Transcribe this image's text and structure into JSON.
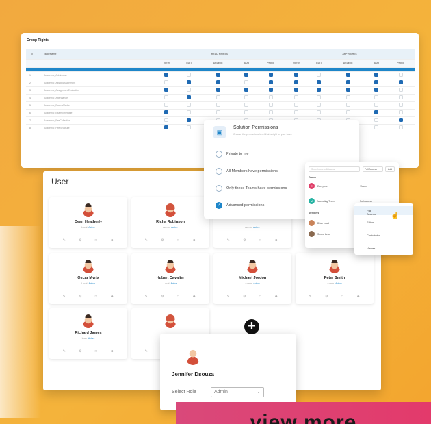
{
  "group_rights": {
    "title": "Group Rights",
    "col_index": "#",
    "col_module": "TableName",
    "group1": "READ RIGHTS",
    "group2": "APP RIGHTS",
    "sub_headers": [
      "VIEW",
      "EDIT",
      "DELETE",
      "ADD",
      "PRINT",
      "VIEW",
      "EDIT",
      "DELETE",
      "ADD",
      "PRINT"
    ],
    "rows": [
      {
        "n": "1",
        "name": "Academic_Admission",
        "checks": [
          1,
          0,
          1,
          1,
          1,
          1,
          0,
          1,
          1,
          0
        ]
      },
      {
        "n": "2",
        "name": "Academic_AssignAssignment",
        "checks": [
          0,
          1,
          1,
          0,
          1,
          1,
          1,
          1,
          1,
          1
        ]
      },
      {
        "n": "3",
        "name": "Academic_AssignmentEvaluation",
        "checks": [
          1,
          0,
          1,
          1,
          1,
          1,
          1,
          1,
          1,
          0
        ]
      },
      {
        "n": "4",
        "name": "Academic_Attendance",
        "checks": [
          0,
          1,
          0,
          0,
          0,
          0,
          0,
          0,
          0,
          0
        ]
      },
      {
        "n": "5",
        "name": "Academic_ExamsMarks",
        "checks": [
          0,
          0,
          0,
          0,
          0,
          0,
          0,
          0,
          0,
          0
        ]
      },
      {
        "n": "6",
        "name": "Academic_ExamTimetable",
        "checks": [
          1,
          0,
          0,
          0,
          0,
          0,
          0,
          0,
          1,
          0
        ]
      },
      {
        "n": "7",
        "name": "Academic_FeeCollection",
        "checks": [
          0,
          1,
          0,
          0,
          0,
          0,
          0,
          0,
          0,
          1
        ]
      },
      {
        "n": "8",
        "name": "Academic_FeeStructure",
        "checks": [
          1,
          0,
          0,
          0,
          0,
          0,
          0,
          0,
          0,
          0
        ]
      }
    ]
  },
  "users_panel": {
    "title": "User",
    "cards": [
      {
        "name": "Dean Heatherly",
        "role": "Local",
        "status": "Active",
        "hair": "d"
      },
      {
        "name": "Richa Robinson",
        "role": "Admin",
        "status": "Active",
        "hair": "r"
      },
      {
        "name": "",
        "role": "Admin",
        "status": "Active",
        "hair": "d"
      },
      {
        "name": "Oscar Myrix",
        "role": "Local",
        "status": "Active",
        "hair": "d"
      },
      {
        "name": "Hubert Cavalier",
        "role": "Local",
        "status": "Active",
        "hair": "d"
      },
      {
        "name": "Michael Jordon",
        "role": "Admin",
        "status": "Active",
        "hair": "d"
      },
      {
        "name": "Peter Smith",
        "role": "Admin",
        "status": "Active",
        "hair": "d"
      },
      {
        "name": "Richard James",
        "role": "User",
        "status": "Active",
        "hair": "d"
      },
      {
        "name": "",
        "role": "",
        "status": "",
        "hair": "r"
      }
    ],
    "add_label": "+"
  },
  "permissions": {
    "title": "Solution Permissions",
    "subtitle": "Choose the permissions level that is right for your team",
    "options": [
      {
        "label": "Private to me",
        "selected": false
      },
      {
        "label": "All Members have permissions",
        "selected": false
      },
      {
        "label": "Only these Teams have permissions",
        "selected": false
      },
      {
        "label": "Advanced permissions",
        "selected": true
      }
    ]
  },
  "teams": {
    "search_placeholder": "Search users & teams",
    "access_select": "Full Access",
    "add_label": "Add",
    "section_teams": "Teams",
    "section_members": "Members",
    "entries": [
      {
        "name": "Everyone",
        "access": "Viewer",
        "color": "#e0406a",
        "initial": "E"
      },
      {
        "name": "Marketing Team",
        "access": "Full Access",
        "color": "#26b3a3",
        "initial": "M"
      },
      {
        "name": "Brian Lead",
        "access": "",
        "color": "#c9845a",
        "initial": ""
      },
      {
        "name": "Scope Lead",
        "access": "",
        "color": "#8a6a50",
        "initial": ""
      }
    ]
  },
  "role_menu": {
    "items": [
      "Full Access",
      "Editor",
      "Contributor",
      "Viewer"
    ]
  },
  "jennifer": {
    "name": "Jennifer Dsouza",
    "select_label": "Select Role",
    "select_value": "Admin"
  },
  "cta": {
    "label": "view more"
  }
}
